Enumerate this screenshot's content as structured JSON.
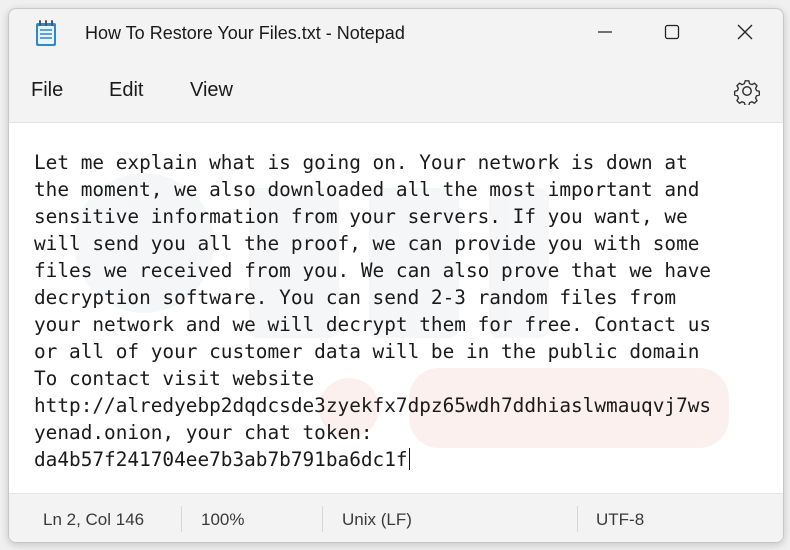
{
  "window": {
    "title": "How To Restore Your Files.txt - Notepad"
  },
  "menu": {
    "file": "File",
    "edit": "Edit",
    "view": "View"
  },
  "editor": {
    "lines": [
      "Let me explain what is going on. Your network is down at",
      "the moment, we also downloaded all the most important and",
      "sensitive information from your servers. If you want, we",
      "will send you all the proof, we can provide you with some",
      "files we received from you. We can also prove that we have",
      "decryption software. You can send 2-3 random files from",
      "your network and we will decrypt them for free. Contact us",
      "or all of your customer data will be in the public domain",
      "To contact visit website",
      "http://alredyebp2dqdcsde3zyekfx7dpz65wdh7ddhiaslwmauqvj7ws",
      "yenad.onion, your chat token:",
      "da4b57f241704ee7b3ab7b791ba6dc1f"
    ]
  },
  "status": {
    "position": "Ln 2, Col 146",
    "zoom": "100%",
    "line_endings": "Unix (LF)",
    "encoding": "UTF-8"
  },
  "colors": {
    "window_bg": "#f3f3f3",
    "editor_bg": "#ffffff",
    "text": "#1a1a1a",
    "icon_blue": "#3d8fd6"
  },
  "icons": {
    "app": "notepad-icon",
    "minimize": "minimize-icon",
    "maximize": "maximize-icon",
    "close": "close-icon",
    "settings": "gear-icon"
  }
}
